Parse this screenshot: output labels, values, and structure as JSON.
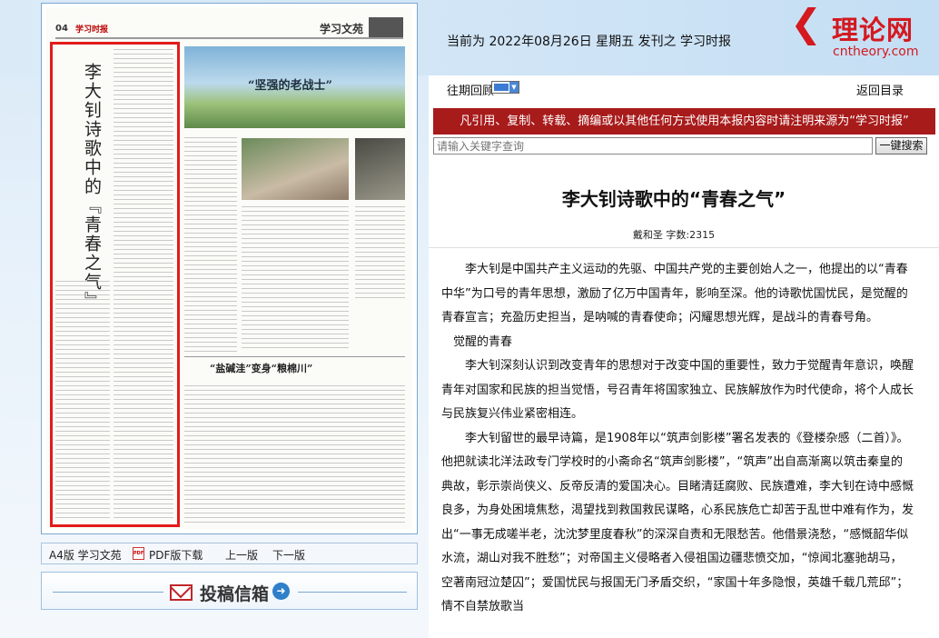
{
  "header": {
    "current_issue_text": "当前为 2022年08月26日 星期五 发刊之 学习时报",
    "brand_cn": "理论网",
    "brand_url": "cntheory.com"
  },
  "nav": {
    "past_issues_label": "往期回顾",
    "back_to_directory": "返回目录"
  },
  "notice": "凡引用、复制、转载、摘编或以其他任何方式使用本报内容时请注明来源为“学习时报”",
  "search": {
    "placeholder": "请输入关键字查询",
    "button_label": "一键搜索"
  },
  "newspaper": {
    "page_no": "04",
    "logo_text": "学习时报",
    "section_title": "学习文苑",
    "vertical_title": "李大钊诗歌中的『青春之气』",
    "image_caption": "“坚强的老战士”",
    "middle_title": "“盐碱洼”变身“粮棉川”"
  },
  "page_links": {
    "section_label": "A4版 学习文苑",
    "pdf_download": "PDF版下载",
    "prev": "上一版",
    "next": "下一版"
  },
  "submit_box": {
    "label": "投稿信箱"
  },
  "article": {
    "title": "李大钊诗歌中的“青春之气”",
    "byline": "戴和圣 字数:2315",
    "paragraphs": [
      "李大钊是中国共产主义运动的先驱、中国共产党的主要创始人之一，他提出的以“青春中华”为口号的青年思想，激励了亿万中国青年，影响至深。他的诗歌忧国忧民，是觉醒的青春宣言；充盈历史担当，是呐喊的青春使命；闪耀思想光辉，是战斗的青春号角。",
      "觉醒的青春",
      "李大钊深刻认识到改变青年的思想对于改变中国的重要性，致力于觉醒青年意识，唤醒青年对国家和民族的担当觉悟，号召青年将国家独立、民族解放作为时代使命，将个人成长与民族复兴伟业紧密相连。",
      "李大钊留世的最早诗篇，是1908年以“筑声剑影楼”署名发表的《登楼杂感（二首）》。他把就读北洋法政专门学校时的小斋命名“筑声剑影楼”，“筑声”出自高渐离以筑击秦皇的典故，彰示崇尚侠义、反帝反清的爱国决心。目睹清廷腐败、民族遭难，李大钊在诗中感慨良多，为身处困境焦愁，渴望找到救国救民谋略，心系民族危亡却苦于乱世中难有作为，发出“一事无成嗟半老，沈沈梦里度春秋”的深深自责和无限愁苦。他借景浇愁，“感慨韶华似水流，湖山对我不胜愁”；对帝国主义侵略者入侵祖国边疆悲愤交加，“惊闻北塞驰胡马，空著南冠泣楚囚”；爱国忧民与报国无门矛盾交织，“家国十年多隐恨，英雄千载几荒邱”；情不自禁放歌当"
    ]
  },
  "colors": {
    "notice_bg": "#a81b1b",
    "brand_red": "#d4191f",
    "highlight_border": "#e21b1b"
  }
}
